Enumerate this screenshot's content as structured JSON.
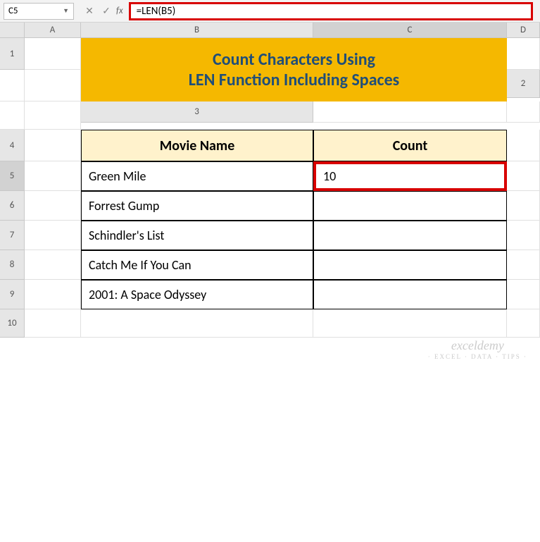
{
  "toolbar": {
    "name_box": "C5",
    "formula": "=LEN(B5)",
    "fx_label": "fx"
  },
  "columns": [
    "A",
    "B",
    "C",
    "D"
  ],
  "rows": [
    "1",
    "2",
    "3",
    "4",
    "5",
    "6",
    "7",
    "8",
    "9",
    "10"
  ],
  "title_line1": "Count Characters Using",
  "title_line2": "LEN Function Including Spaces",
  "headers": {
    "movie": "Movie Name",
    "count": "Count"
  },
  "movies": {
    "r5": "Green Mile",
    "r6": "Forrest Gump",
    "r7": "Schindler's List",
    "r8": "Catch  Me If You Can",
    "r9": "2001: A Space Odyssey"
  },
  "counts": {
    "r5": "10",
    "r6": "",
    "r7": "",
    "r8": "",
    "r9": ""
  },
  "watermark": {
    "main": "exceldemy",
    "sub": "· EXCEL · DATA · TIPS ·"
  }
}
